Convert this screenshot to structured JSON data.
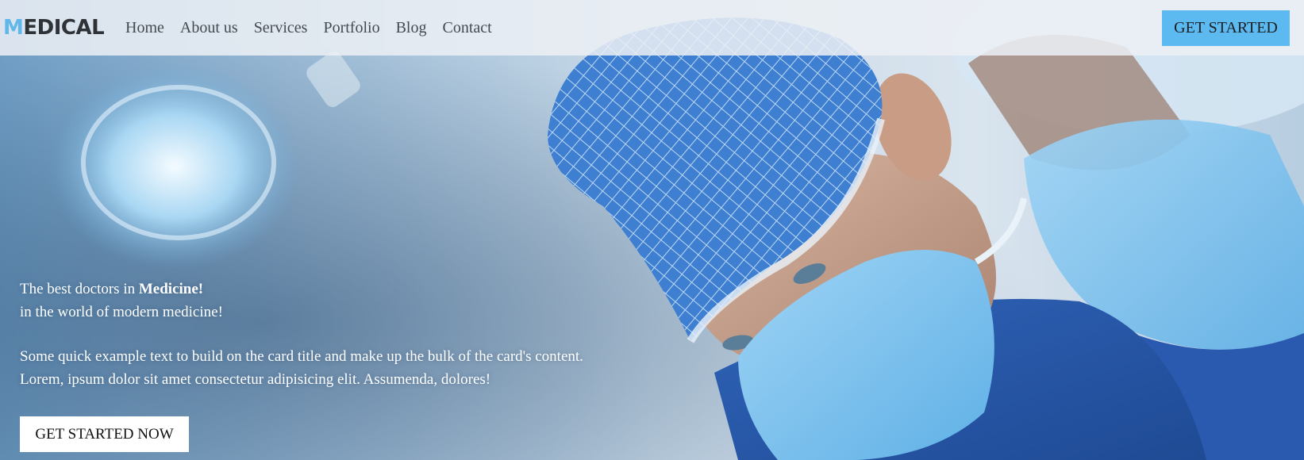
{
  "brand": {
    "first_letter": "M",
    "rest": "EDICAL"
  },
  "nav": {
    "links": [
      "Home",
      "About us",
      "Services",
      "Portfolio",
      "Blog",
      "Contact"
    ],
    "cta_label": "GET STARTED"
  },
  "hero": {
    "line1_prefix": "The best doctors in ",
    "line1_strong": "Medicine!",
    "line2": "in the world of modern medicine!",
    "line3": "Some quick example text to build on the card title and make up the bulk of the card's content.",
    "line4": "Lorem, ipsum dolor sit amet consectetur adipisicing elit. Assumenda, dolores!",
    "cta_label": "GET STARTED NOW",
    "image_subject": "surgeons-in-blue-scrubs-photo"
  },
  "colors": {
    "accent": "#5cbaf0",
    "brand_accent": "#5fb7ea",
    "text_dark": "#2f3338",
    "navbar_bg": "#ecf0f4"
  }
}
